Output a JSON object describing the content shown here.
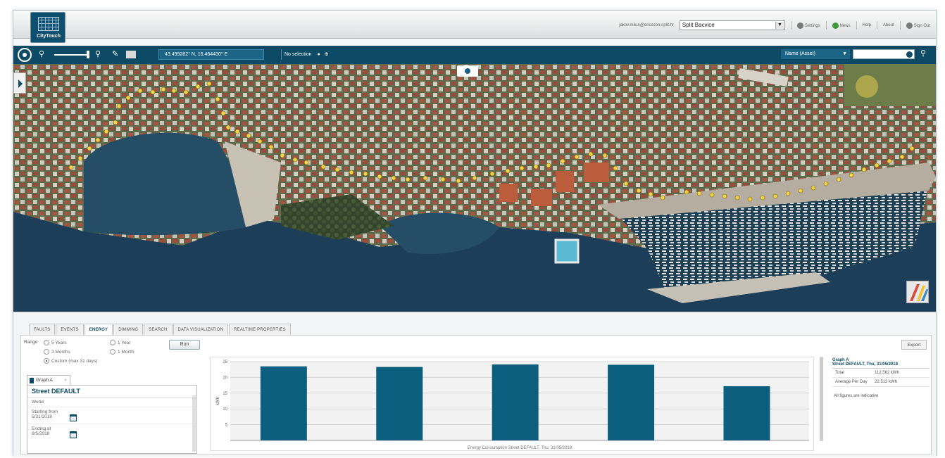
{
  "header": {
    "logo_text": "CityTouch",
    "user_email": "jakov.milun@ericsson-split.hr",
    "city_select": "Split Bacvice",
    "settings_label": "Settings",
    "news_label": "News",
    "news_count": "1",
    "help_label": "Help",
    "about_label": "About",
    "signout_label": "Sign Out"
  },
  "toolbar": {
    "coordinates": "43.499282° N,  16.464430° E",
    "selection": "No selection",
    "name_select": "Name (Asset)",
    "search_placeholder": ""
  },
  "bottom": {
    "tabs": [
      "FAULTS",
      "EVENTS",
      "ENERGY",
      "DIMMING",
      "SEARCH",
      "DATA VISUALIZATION",
      "REALTIME PROPERTIES"
    ],
    "active_tab": "ENERGY",
    "range_label": "Range",
    "range_options": [
      "5 Years",
      "1 Year",
      "3 Months",
      "1 Month",
      "Custom (max 31 days)"
    ],
    "range_selected": "Custom (max 31 days)",
    "run_label": "Run",
    "export_label": "Export",
    "graph_tab_label": "Graph A",
    "graph_tab_close": "×",
    "panel_title": "Street DEFAULT",
    "panel_scope": "World",
    "start_label": "Starting from",
    "start_date": "5/31/2018",
    "end_label": "Ending at",
    "end_date": "6/5/2018"
  },
  "summary": {
    "graph_name": "Graph A",
    "subtitle": "Street DEFAULT, Thu, 31/05/2018",
    "rows": [
      {
        "label": "Total",
        "value": "112.562 kWh"
      },
      {
        "label": "Average Per Day",
        "value": "22.512 kWh"
      }
    ],
    "note": "All figures are indicative"
  },
  "chart_data": {
    "type": "bar",
    "title": "",
    "xlabel": "Energy Consumption Street DEFAULT, Thu, 31/05/2018",
    "ylabel": "kWh",
    "categories": [
      "",
      "",
      "",
      "",
      ""
    ],
    "values": [
      23.5,
      23.3,
      24.1,
      24.0,
      17.2
    ],
    "ylim": [
      0,
      25
    ],
    "yticks": [
      5,
      10,
      15,
      20,
      25
    ],
    "grid": true,
    "color": "#0d5f80"
  }
}
